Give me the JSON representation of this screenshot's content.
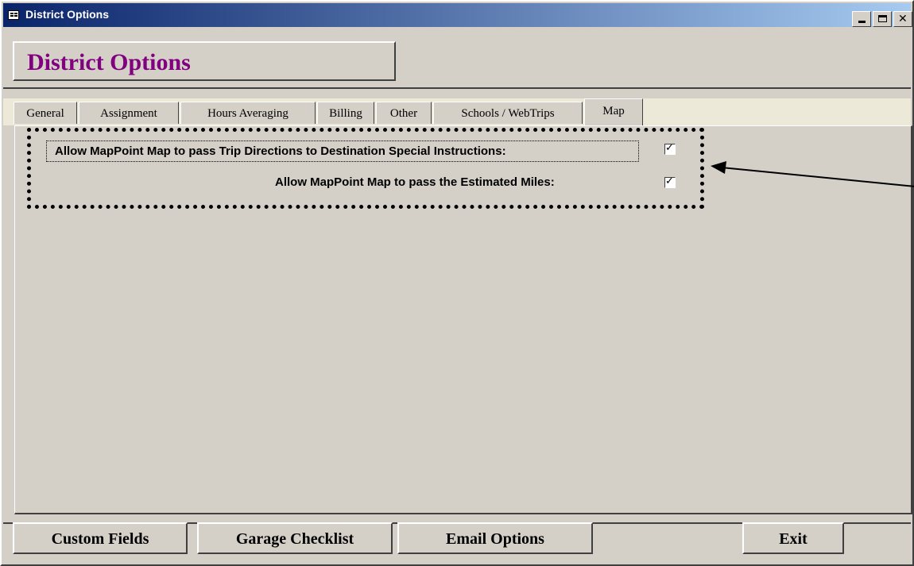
{
  "window": {
    "title": "District Options",
    "controls": [
      "minimize-icon",
      "maximize-icon",
      "close-icon"
    ]
  },
  "header": {
    "title": "District Options"
  },
  "tabs": [
    {
      "label": "General",
      "active": false
    },
    {
      "label": "Assignment",
      "active": false
    },
    {
      "label": "Hours Averaging",
      "active": false
    },
    {
      "label": "Billing",
      "active": false
    },
    {
      "label": "Other",
      "active": false
    },
    {
      "label": "Schools / WebTrips",
      "active": false
    },
    {
      "label": "Map",
      "active": true
    }
  ],
  "options": [
    {
      "label": "Allow MapPoint Map to pass Trip Directions to Destination Special Instructions:",
      "checked": true
    },
    {
      "label": "Allow MapPoint Map to pass the Estimated Miles:",
      "checked": true
    }
  ],
  "buttons": {
    "custom_fields": "Custom Fields",
    "garage_checklist": "Garage Checklist",
    "email_options": "Email Options",
    "exit": "Exit"
  },
  "colors": {
    "title_accent": "#800080",
    "titlebar": "#0a246a",
    "face": "#d4d0c8"
  }
}
